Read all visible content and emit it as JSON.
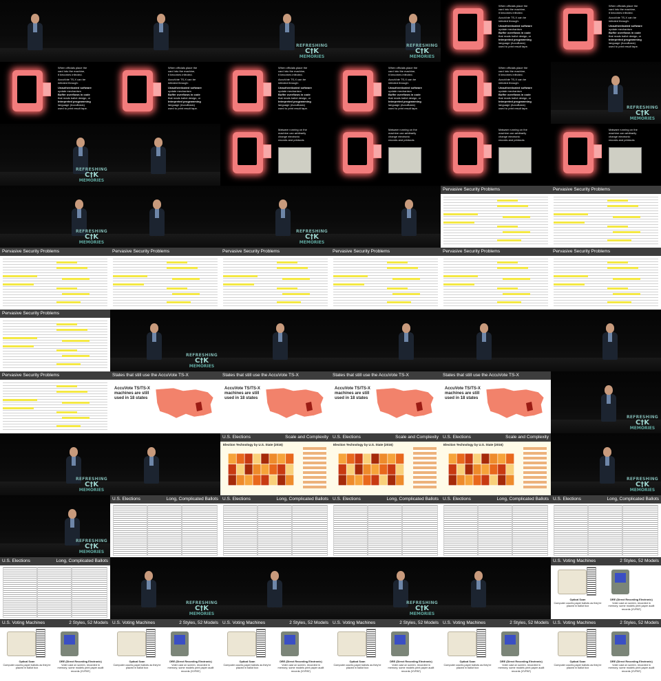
{
  "logo": {
    "line1": "REFRESHING",
    "line2": "C†K",
    "line3": "MEMORIES"
  },
  "machine_text_a": [
    "When officials place the",
    "card into the machine,",
    "it becomes infected.",
    "AccuVote TS-X can be",
    "infected through:",
    "Unauthenticated software",
    "update mechanism",
    "Buffer overflows in code",
    "that reads ballot design, or",
    "Interpreted programming",
    "language (AccuBasic)",
    "used to print result tape."
  ],
  "machine_text_b": [
    "Malware running on the",
    "machine can arbitrarily",
    "change electronic",
    "records and printouts"
  ],
  "slides": {
    "pervasive": "Pervasive Security Problems",
    "states": "States that still use the AccuVote TS-X",
    "states_body": "AccuVote TS/TS-X machines are still used in 18 states",
    "elections": "U.S. Elections",
    "scale": "Scale and Complexity",
    "scale_map_title": "Election Technology by U.S. State (2016)",
    "long": "Long, Complicated Ballots",
    "machines": "U.S. Voting Machines",
    "machines_right": "2 Styles, 52 Models",
    "optical": "Optical Scan",
    "optical_desc": "Computer counts paper ballots as they're placed in ballot box",
    "dre": "DRE (Direct Recording Electronic)",
    "dre_desc": "Voter cast on screen, recorded in memory; some models print paper audit records (VVPAT)"
  },
  "frames": [
    [
      "speaker",
      "speaker",
      "speaker-logo",
      "speaker-logo",
      "machine-a",
      "machine-a"
    ],
    [
      "machine-a",
      "machine-a",
      "machine-a",
      "machine-a",
      "machine-a",
      "speaker-logo"
    ],
    [
      "speaker-logo",
      "speaker",
      "machine-b",
      "machine-b",
      "machine-b",
      "machine-b"
    ],
    [
      "speaker-logo",
      "speaker",
      "speaker-logo",
      "speaker",
      "pervasive",
      "pervasive"
    ],
    [
      "pervasive",
      "pervasive",
      "pervasive",
      "pervasive",
      "pervasive",
      "pervasive"
    ],
    [
      "pervasive",
      "speaker-logo",
      "speaker",
      "speaker",
      "speaker",
      "speaker"
    ],
    [
      "pervasive",
      "states",
      "states",
      "states",
      "states",
      "speaker-logo"
    ],
    [
      "speaker-logo",
      "speaker",
      "scale",
      "scale",
      "scale",
      "speaker-logo"
    ],
    [
      "speaker-logo",
      "long",
      "long",
      "long",
      "long",
      "long"
    ],
    [
      "long",
      "speaker-logo",
      "speaker",
      "speaker-logo",
      "speaker",
      "machines"
    ],
    [
      "machines",
      "machines",
      "machines",
      "machines",
      "machines",
      "machines"
    ]
  ]
}
